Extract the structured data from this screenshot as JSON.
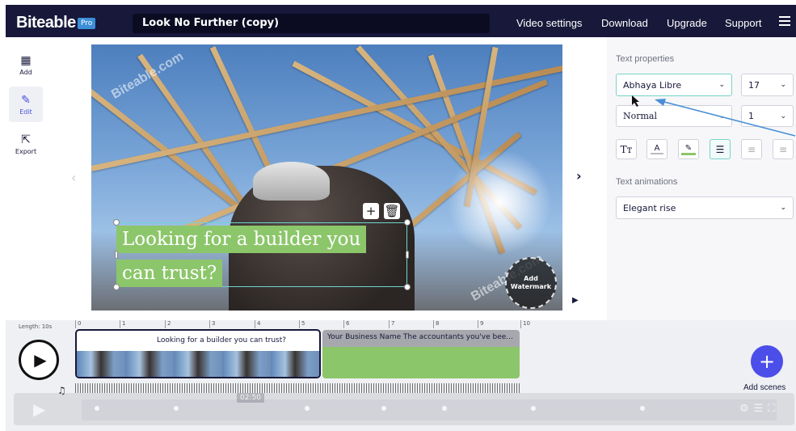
{
  "header": {
    "logo": "Biteable",
    "badge": "Pro",
    "project_title": "Look No Further (copy)",
    "nav": [
      "Video settings",
      "Download",
      "Upgrade",
      "Support"
    ]
  },
  "sidebar": {
    "items": [
      {
        "label": "Add",
        "icon": "grid-icon"
      },
      {
        "label": "Edit",
        "icon": "pencil-icon"
      },
      {
        "label": "Export",
        "icon": "export-icon"
      }
    ]
  },
  "canvas": {
    "watermark_text": "Biteable.com",
    "caption_lines": [
      "Looking for a builder you",
      "can trust?"
    ],
    "add_watermark": [
      "Add",
      "Watermark"
    ]
  },
  "text_properties": {
    "heading": "Text properties",
    "font": "Abhaya Libre",
    "size": "17",
    "weight": "Normal",
    "line_height": "1",
    "animations_heading": "Text animations",
    "animation": "Elegant rise"
  },
  "timeline": {
    "length_label": "Length: 10s",
    "ruler": [
      "0",
      "1",
      "2",
      "3",
      "4",
      "5",
      "6",
      "7",
      "8",
      "9",
      "10"
    ],
    "scene1_caption": "Looking for a builder you can trust?",
    "scene2_caption": "Your Business Name The accountants you've bee...",
    "add_scenes": "Add scenes",
    "player_time": "02:50"
  },
  "colors": {
    "header_bg": "#17183a",
    "accent": "#4b4ee8",
    "caption_bg": "#8cc66a",
    "focus": "#79d3c8"
  }
}
